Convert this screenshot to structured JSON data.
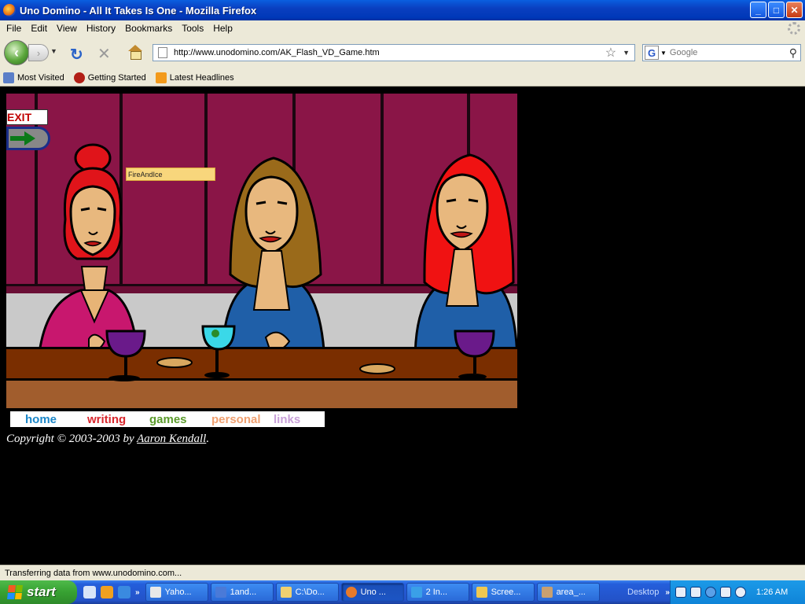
{
  "window": {
    "title": "Uno Domino - All It Takes Is One - Mozilla Firefox",
    "controls": [
      "_",
      "□",
      "✕"
    ]
  },
  "menu": [
    {
      "label": "File"
    },
    {
      "label": "Edit"
    },
    {
      "label": "View"
    },
    {
      "label": "History"
    },
    {
      "label": "Bookmarks"
    },
    {
      "label": "Tools"
    },
    {
      "label": "Help"
    }
  ],
  "nav": {
    "url": "http://www.unodomino.com/AK_Flash_VD_Game.htm",
    "search_placeholder": "Google"
  },
  "bookmarks": [
    {
      "label": "Most Visited",
      "icon": "most-visited-icon"
    },
    {
      "label": "Getting Started",
      "icon": "firefox-icon"
    },
    {
      "label": "Latest Headlines",
      "icon": "rss-icon"
    }
  ],
  "game": {
    "exit_label": "EXIT",
    "player_name": "FireAndIce"
  },
  "site_nav": [
    {
      "label": "home",
      "color": "#1a86c8"
    },
    {
      "label": "writing",
      "color": "#d8262c"
    },
    {
      "label": "games",
      "color": "#5a9a2a"
    },
    {
      "label": "personal",
      "color": "#f0a070"
    },
    {
      "label": "links",
      "color": "#c8a0d8"
    }
  ],
  "footer": {
    "copyright_prefix": "Copyright © 2003-2003 by ",
    "author": "Aaron Kendall",
    "suffix": "."
  },
  "status": "Transferring data from www.unodomino.com...",
  "taskbar": {
    "start_label": "start",
    "tasks": [
      {
        "label": "Yaho...",
        "color": "#e8e8e8"
      },
      {
        "label": "1and...",
        "color": "#4a7ad8"
      },
      {
        "label": "C:\\Do...",
        "color": "#f0d070"
      },
      {
        "label": "Uno ...",
        "color": "#e87a2a",
        "active": true
      },
      {
        "label": "2 In...",
        "color": "#3aa0e8"
      },
      {
        "label": "Scree...",
        "color": "#f0c850"
      },
      {
        "label": "area_...",
        "color": "#c8a070"
      }
    ],
    "desktop_label": "Desktop",
    "clock": "1:26 AM"
  }
}
